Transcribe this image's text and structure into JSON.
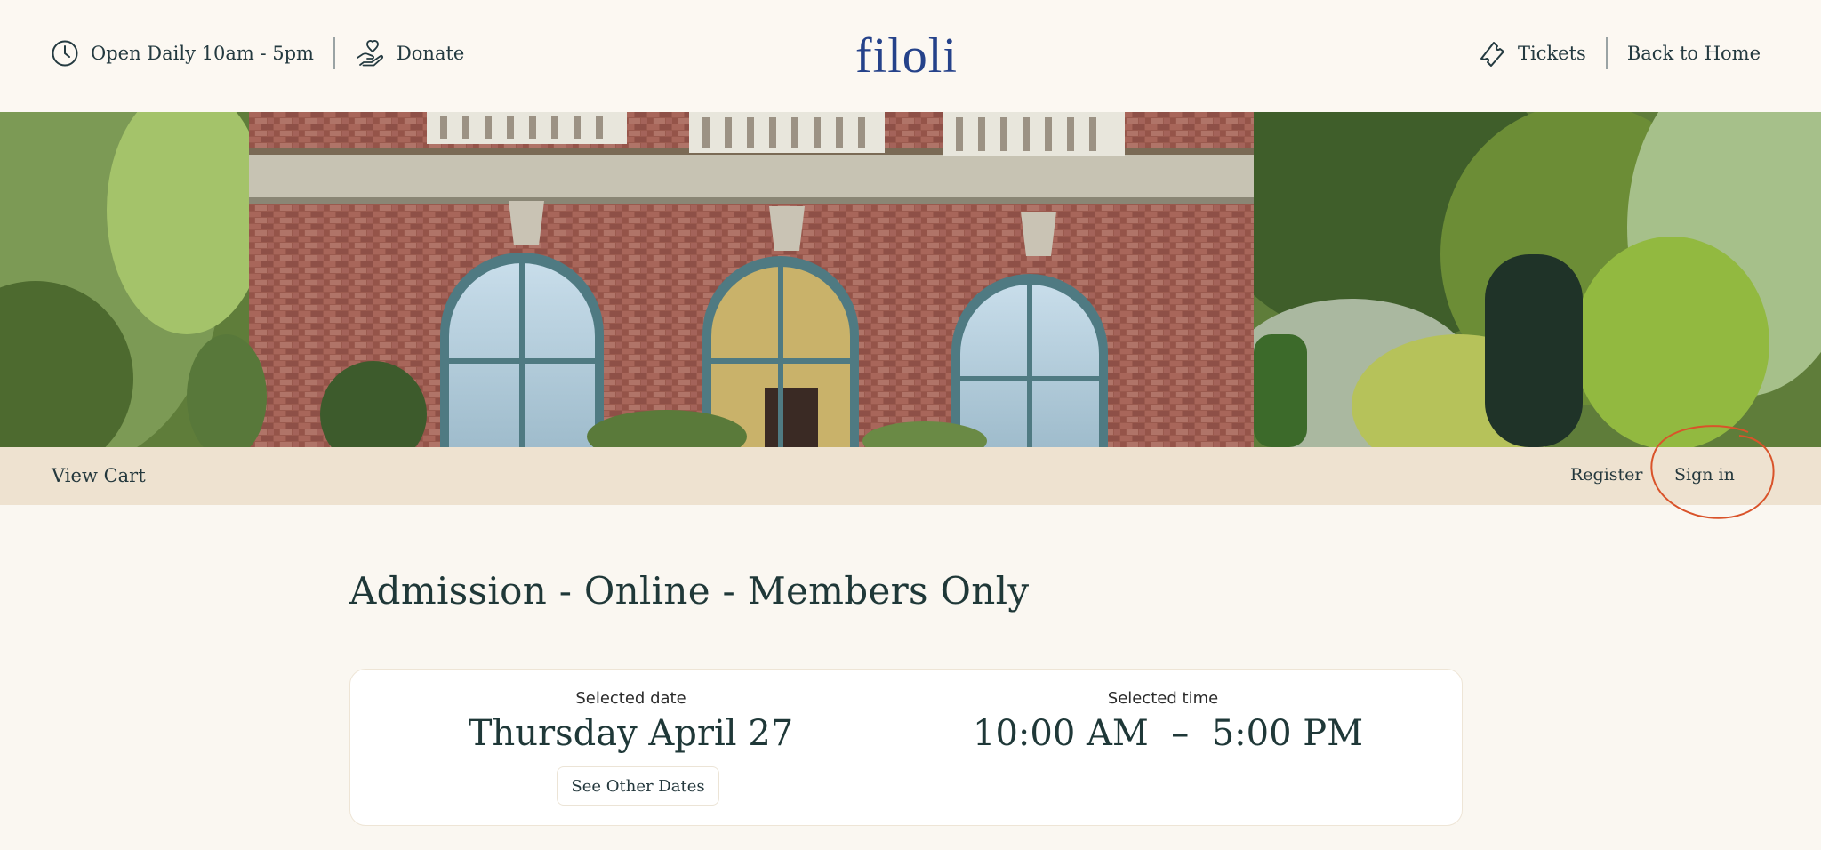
{
  "header": {
    "hours_label": "Open Daily 10am - 5pm",
    "donate_label": "Donate",
    "logo_text": "filoli",
    "tickets_label": "Tickets",
    "back_home_label": "Back to Home"
  },
  "account_bar": {
    "view_cart_label": "View Cart",
    "register_label": "Register",
    "sign_in_label": "Sign in"
  },
  "main": {
    "title": "Admission - Online - Members Only",
    "selection": {
      "date_caption": "Selected date",
      "date_value": "Thursday April 27",
      "other_dates_label": "See Other Dates",
      "time_caption": "Selected time",
      "time_value": "10:00 AM  –  5:00 PM"
    }
  },
  "colors": {
    "header_bg": "#fcf8f2",
    "logo": "#25428a",
    "account_bar_bg": "#eee2d0",
    "page_bg": "#faf7f1",
    "annotation": "#d9532a"
  },
  "icons": [
    "clock-icon",
    "donate-hand-icon",
    "ticket-icon"
  ]
}
